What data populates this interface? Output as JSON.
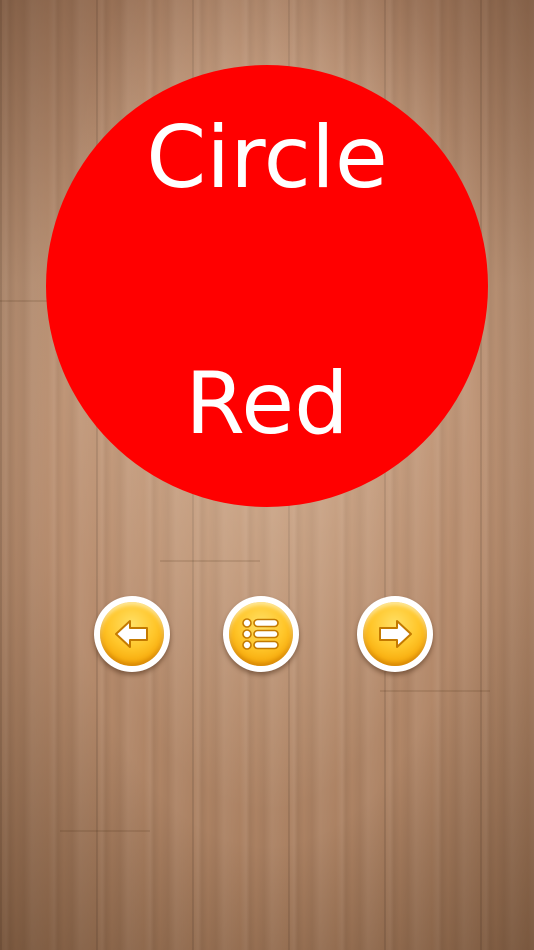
{
  "screen": {
    "background": "wood-texture",
    "background_color": "#b98e6f"
  },
  "shape_card": {
    "shape_name": "Circle",
    "color_name": "Red",
    "fill_color": "#ff0000",
    "text_color": "#ffffff"
  },
  "nav_buttons": {
    "previous": {
      "icon": "arrow-left-icon"
    },
    "menu": {
      "icon": "list-icon"
    },
    "next": {
      "icon": "arrow-right-icon"
    },
    "accent_color": "#ffc62a"
  }
}
